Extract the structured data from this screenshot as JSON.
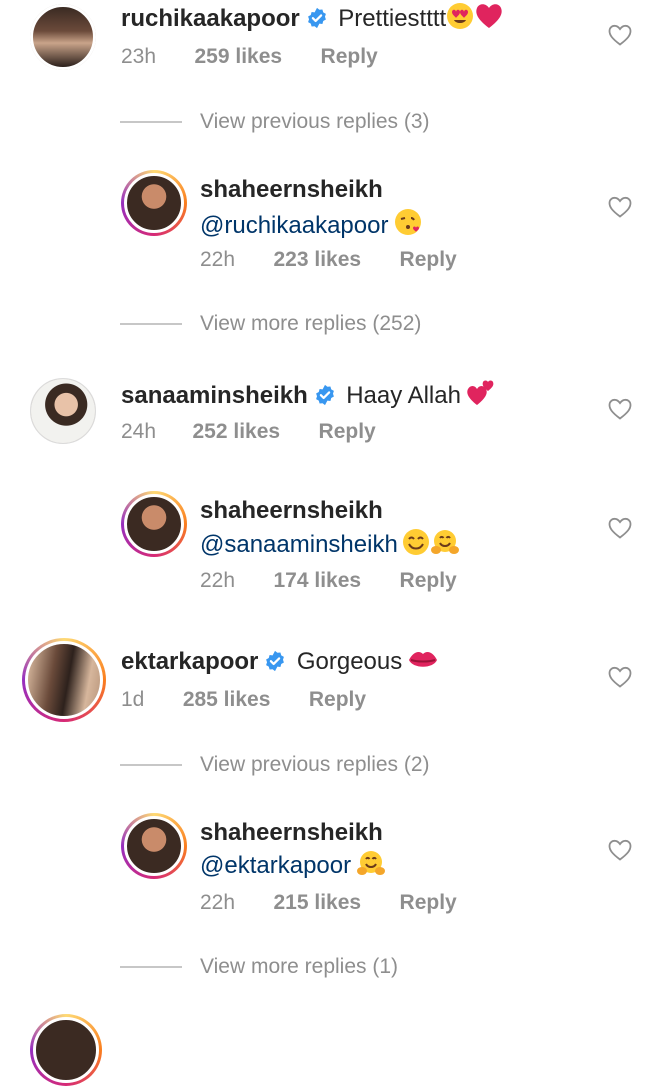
{
  "comments": [
    {
      "username": "ruchikaakapoor",
      "text": "Prettiestttt",
      "time": "23h",
      "likes": "259 likes",
      "reply": "Reply"
    },
    {
      "username": "sanaaminsheikh",
      "text": "Haay Allah",
      "time": "24h",
      "likes": "252 likes",
      "reply": "Reply"
    },
    {
      "username": "ektarkapoor",
      "text": "Gorgeous",
      "time": "1d",
      "likes": "285 likes",
      "reply": "Reply"
    }
  ],
  "replies": [
    {
      "username": "shaheernsheikh",
      "mention": "@ruchikaakapoor",
      "time": "22h",
      "likes": "223 likes",
      "reply": "Reply"
    },
    {
      "username": "shaheernsheikh",
      "mention": "@sanaaminsheikh",
      "time": "22h",
      "likes": "174 likes",
      "reply": "Reply"
    },
    {
      "username": "shaheernsheikh",
      "mention": "@ektarkapoor",
      "time": "22h",
      "likes": "215 likes",
      "reply": "Reply"
    }
  ],
  "view_links": [
    "View previous replies (3)",
    "View more replies (252)",
    "View previous replies (2)",
    "View more replies (1)"
  ],
  "colors": {
    "verified": "#3897f0",
    "mention": "#003569",
    "meta": "#8e8e8e"
  }
}
